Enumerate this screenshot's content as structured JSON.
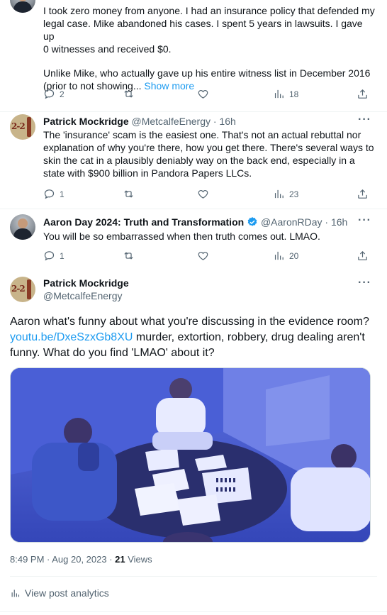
{
  "tweet1": {
    "body_line1": "I took zero money from anyone. I had an insurance policy that defended my",
    "body_line2": "legal case. Mike abandoned his cases. I spent 5 years in lawsuits. I gave up",
    "body_line3": "0 witnesses and received $0.",
    "body_line4": "Unlike Mike, who actually gave up his entire witness list in December 2016",
    "body_line5": "(prior to not showing...",
    "show_more": "Show more",
    "replies": "2",
    "views": "18"
  },
  "tweet2": {
    "name": "Patrick Mockridge",
    "handle": "@MetcalfeEnergy · 16h",
    "body_line1": "The 'insurance' scam is the easiest one. That's not an actual rebuttal nor",
    "body_line2": "explanation of why you're there, how you get there. There's several ways to",
    "body_line3": "skin the cat in a plausibly deniably way on the back end, especially in a",
    "body_line4": "state with $900 billion in Pandora Papers LLCs.",
    "replies": "1",
    "views": "23"
  },
  "tweet3": {
    "name": "Aaron Day 2024: Truth and Transformation",
    "handle": "@AaronRDay · 16h",
    "body": "You will be so embarrassed when then truth comes out. LMAO.",
    "replies": "1",
    "views": "20"
  },
  "main_tweet": {
    "name": "Patrick Mockridge",
    "handle": "@MetcalfeEnergy",
    "text_line1": "Aaron what's funny about what you're discussing in the evidence room?",
    "link": "youtu.be/DxeSzxGb8XU",
    "text_line2_rest": " murder, extortion, robbery, drug dealing aren't",
    "text_line3": "funny. What do you find 'LMAO' about it?",
    "timestamp": "8:49 PM · Aug 20, 2023 · ",
    "views_count": "21",
    "views_label": " Views",
    "analytics_label": "View post analytics"
  },
  "colors": {
    "link": "#1d9bf0",
    "secondary_text": "#536471",
    "verified": "#1d9bf0"
  },
  "icons": [
    "reply-icon",
    "retweet-icon",
    "like-icon",
    "views-icon",
    "share-icon",
    "more-icon",
    "verified-badge-icon",
    "analytics-icon"
  ]
}
